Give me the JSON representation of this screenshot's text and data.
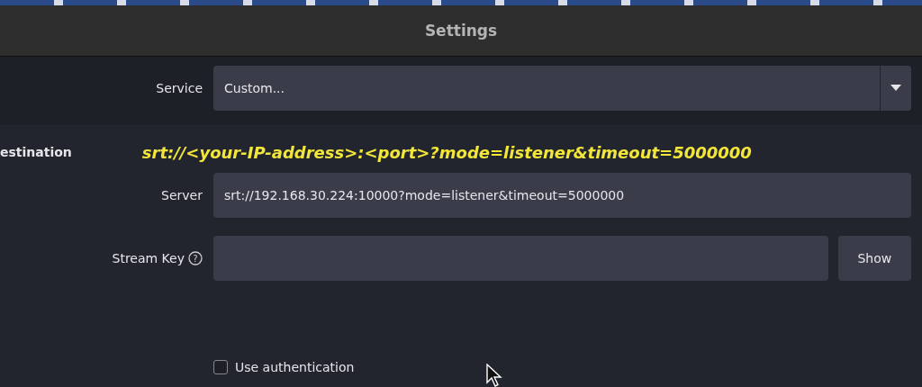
{
  "window": {
    "title": "Settings"
  },
  "service": {
    "label": "Service",
    "value": "Custom..."
  },
  "destination": {
    "heading": "estination",
    "caption": "srt://<your-IP-address>:<port>?mode=listener&timeout=5000000",
    "server": {
      "label": "Server",
      "value": "srt://192.168.30.224:10000?mode=listener&timeout=5000000"
    },
    "stream_key": {
      "label": "Stream Key",
      "help": "?",
      "button": "Show"
    },
    "use_authentication": {
      "label": "Use authentication",
      "checked": false
    }
  }
}
